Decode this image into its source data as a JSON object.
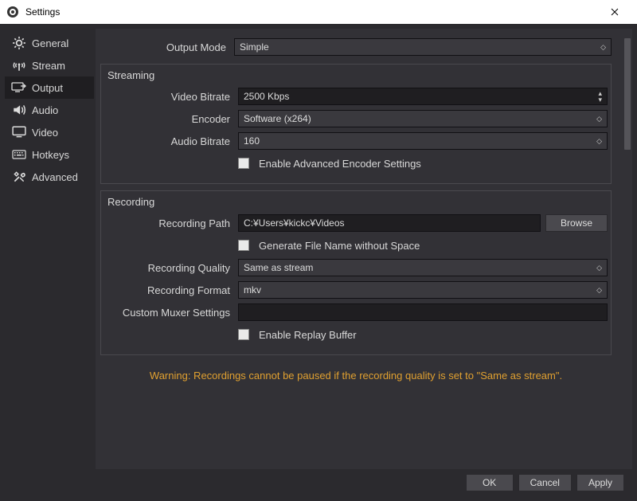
{
  "window": {
    "title": "Settings"
  },
  "sidebar": {
    "items": [
      {
        "label": "General"
      },
      {
        "label": "Stream"
      },
      {
        "label": "Output"
      },
      {
        "label": "Audio"
      },
      {
        "label": "Video"
      },
      {
        "label": "Hotkeys"
      },
      {
        "label": "Advanced"
      }
    ],
    "active_index": 2
  },
  "output": {
    "output_mode_label": "Output Mode",
    "output_mode_value": "Simple",
    "streaming": {
      "title": "Streaming",
      "video_bitrate_label": "Video Bitrate",
      "video_bitrate_value": "2500 Kbps",
      "encoder_label": "Encoder",
      "encoder_value": "Software (x264)",
      "audio_bitrate_label": "Audio Bitrate",
      "audio_bitrate_value": "160",
      "enable_advanced_label": "Enable Advanced Encoder Settings",
      "enable_advanced_checked": false
    },
    "recording": {
      "title": "Recording",
      "path_label": "Recording Path",
      "path_value": "C:¥Users¥kickc¥Videos",
      "browse_label": "Browse",
      "gen_filename_label": "Generate File Name without Space",
      "gen_filename_checked": false,
      "quality_label": "Recording Quality",
      "quality_value": "Same as stream",
      "format_label": "Recording Format",
      "format_value": "mkv",
      "muxer_label": "Custom Muxer Settings",
      "muxer_value": "",
      "replay_buffer_label": "Enable Replay Buffer",
      "replay_buffer_checked": false
    },
    "warning_text": "Warning: Recordings cannot be paused if the recording quality is set to \"Same as stream\"."
  },
  "footer": {
    "ok": "OK",
    "cancel": "Cancel",
    "apply": "Apply"
  }
}
